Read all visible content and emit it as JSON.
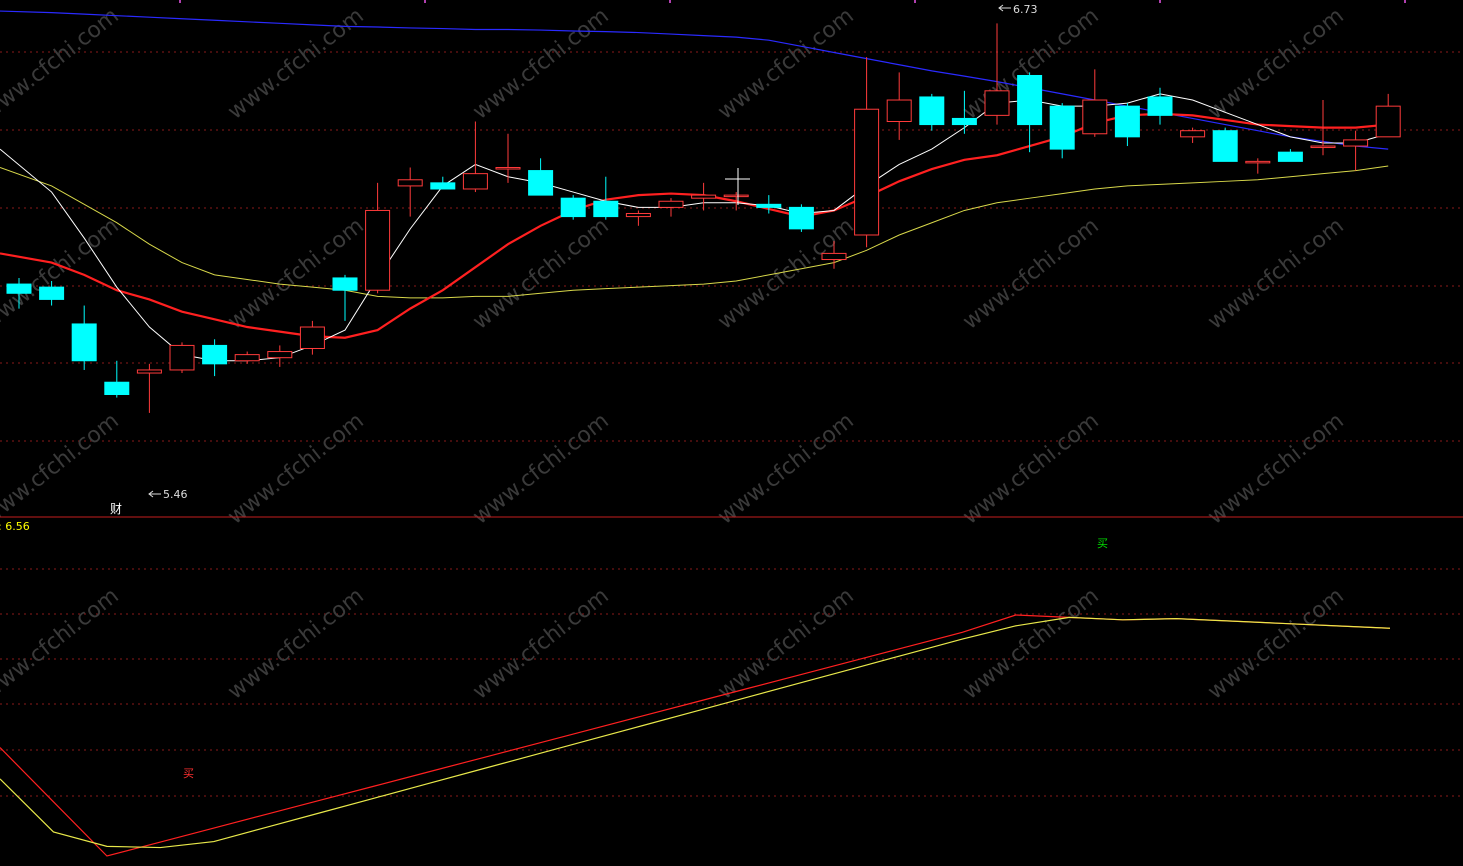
{
  "colors": {
    "background": "#000000",
    "up": "#ff3b3b",
    "down": "#00ffff",
    "gridline": "#8a1a1a",
    "divider": "#c41e1e",
    "ma_fast": "#ffffff",
    "ma_mid": "#ff2020",
    "ma_slow": "#d8d84a",
    "ma_long": "#2a2aff",
    "label_text": "#dddddd",
    "indicator_value": "#ffff00",
    "buy_red": "#ff3030",
    "buy_green": "#00dd00",
    "osc_a": "#ff2020",
    "osc_b": "#e8e84a",
    "watermark": "#3a3a3a"
  },
  "annotations": {
    "high_label": "6.73",
    "low_label": "5.46",
    "finance_marker": "财",
    "indicator_value_label": ": 6.56",
    "buy_signal_1": "买",
    "buy_signal_2": "买"
  },
  "watermark_text": "www.cfchi.com",
  "chart_data": [
    {
      "type": "candlestick",
      "title": "",
      "xlabel": "",
      "ylabel": "",
      "ylim": [
        5.15,
        6.78
      ],
      "grid": true,
      "candles": [
        {
          "o": 5.88,
          "c": 5.85,
          "h": 5.9,
          "l": 5.8
        },
        {
          "o": 5.87,
          "c": 5.83,
          "h": 5.89,
          "l": 5.81
        },
        {
          "o": 5.75,
          "c": 5.63,
          "h": 5.81,
          "l": 5.6
        },
        {
          "o": 5.56,
          "c": 5.52,
          "h": 5.63,
          "l": 5.51
        },
        {
          "o": 5.59,
          "c": 5.6,
          "h": 5.62,
          "l": 5.46
        },
        {
          "o": 5.6,
          "c": 5.68,
          "h": 5.69,
          "l": 5.59
        },
        {
          "o": 5.68,
          "c": 5.62,
          "h": 5.7,
          "l": 5.58
        },
        {
          "o": 5.63,
          "c": 5.65,
          "h": 5.66,
          "l": 5.62
        },
        {
          "o": 5.64,
          "c": 5.66,
          "h": 5.68,
          "l": 5.61
        },
        {
          "o": 5.67,
          "c": 5.74,
          "h": 5.76,
          "l": 5.65
        },
        {
          "o": 5.9,
          "c": 5.86,
          "h": 5.91,
          "l": 5.76
        },
        {
          "o": 5.86,
          "c": 6.12,
          "h": 6.21,
          "l": 5.85
        },
        {
          "o": 6.2,
          "c": 6.22,
          "h": 6.26,
          "l": 6.1
        },
        {
          "o": 6.21,
          "c": 6.19,
          "h": 6.23,
          "l": 6.19
        },
        {
          "o": 6.19,
          "c": 6.24,
          "h": 6.41,
          "l": 6.18
        },
        {
          "o": 6.26,
          "c": 6.26,
          "h": 6.37,
          "l": 6.21
        },
        {
          "o": 6.25,
          "c": 6.17,
          "h": 6.29,
          "l": 6.17
        },
        {
          "o": 6.16,
          "c": 6.1,
          "h": 6.17,
          "l": 6.09
        },
        {
          "o": 6.15,
          "c": 6.1,
          "h": 6.23,
          "l": 6.09
        },
        {
          "o": 6.1,
          "c": 6.11,
          "h": 6.12,
          "l": 6.07
        },
        {
          "o": 6.13,
          "c": 6.15,
          "h": 6.16,
          "l": 6.1
        },
        {
          "o": 6.16,
          "c": 6.17,
          "h": 6.21,
          "l": 6.12
        },
        {
          "o": 6.17,
          "c": 6.17,
          "h": 6.18,
          "l": 6.12
        },
        {
          "o": 6.14,
          "c": 6.13,
          "h": 6.17,
          "l": 6.11
        },
        {
          "o": 6.13,
          "c": 6.06,
          "h": 6.14,
          "l": 6.05
        },
        {
          "o": 5.96,
          "c": 5.98,
          "h": 6.02,
          "l": 5.93
        },
        {
          "o": 6.04,
          "c": 6.45,
          "h": 6.62,
          "l": 6.0
        },
        {
          "o": 6.41,
          "c": 6.48,
          "h": 6.57,
          "l": 6.35
        },
        {
          "o": 6.49,
          "c": 6.4,
          "h": 6.5,
          "l": 6.38
        },
        {
          "o": 6.42,
          "c": 6.4,
          "h": 6.51,
          "l": 6.37
        },
        {
          "o": 6.43,
          "c": 6.51,
          "h": 6.73,
          "l": 6.4
        },
        {
          "o": 6.56,
          "c": 6.4,
          "h": 6.57,
          "l": 6.31
        },
        {
          "o": 6.46,
          "c": 6.32,
          "h": 6.47,
          "l": 6.29
        },
        {
          "o": 6.37,
          "c": 6.48,
          "h": 6.58,
          "l": 6.36
        },
        {
          "o": 6.46,
          "c": 6.36,
          "h": 6.47,
          "l": 6.33
        },
        {
          "o": 6.49,
          "c": 6.43,
          "h": 6.52,
          "l": 6.4
        },
        {
          "o": 6.36,
          "c": 6.38,
          "h": 6.39,
          "l": 6.34
        },
        {
          "o": 6.38,
          "c": 6.28,
          "h": 6.39,
          "l": 6.28
        },
        {
          "o": 6.28,
          "c": 6.28,
          "h": 6.29,
          "l": 6.24
        },
        {
          "o": 6.31,
          "c": 6.28,
          "h": 6.32,
          "l": 6.28
        },
        {
          "o": 6.33,
          "c": 6.33,
          "h": 6.48,
          "l": 6.3
        },
        {
          "o": 6.33,
          "c": 6.35,
          "h": 6.38,
          "l": 6.25
        },
        {
          "o": 6.36,
          "c": 6.46,
          "h": 6.5,
          "l": 6.36
        }
      ],
      "series": [
        {
          "role": "ma_long",
          "values": [
            6.77,
            6.765,
            6.76,
            6.755,
            6.75,
            6.745,
            6.74,
            6.735,
            6.73,
            6.725,
            6.72,
            6.718,
            6.715,
            6.713,
            6.71,
            6.71,
            6.708,
            6.705,
            6.703,
            6.7,
            6.695,
            6.69,
            6.685,
            6.675,
            6.655,
            6.635,
            6.615,
            6.595,
            6.575,
            6.558,
            6.54,
            6.52,
            6.5,
            6.48,
            6.46,
            6.44,
            6.42,
            6.4,
            6.38,
            6.36,
            6.345,
            6.33,
            6.32
          ]
        },
        {
          "role": "ma_slow",
          "values": [
            6.26,
            6.2,
            6.14,
            6.08,
            6.01,
            5.95,
            5.91,
            5.895,
            5.88,
            5.87,
            5.86,
            5.84,
            5.835,
            5.835,
            5.84,
            5.84,
            5.85,
            5.86,
            5.865,
            5.87,
            5.875,
            5.88,
            5.89,
            5.91,
            5.93,
            5.95,
            5.99,
            6.04,
            6.08,
            6.12,
            6.145,
            6.16,
            6.175,
            6.19,
            6.2,
            6.205,
            6.21,
            6.215,
            6.22,
            6.23,
            6.24,
            6.25,
            6.265
          ]
        },
        {
          "role": "ma_mid",
          "values": [
            5.98,
            5.95,
            5.91,
            5.86,
            5.83,
            5.79,
            5.765,
            5.74,
            5.725,
            5.71,
            5.705,
            5.73,
            5.8,
            5.86,
            5.935,
            6.01,
            6.07,
            6.12,
            6.155,
            6.17,
            6.175,
            6.17,
            6.15,
            6.125,
            6.1,
            6.12,
            6.165,
            6.215,
            6.255,
            6.285,
            6.3,
            6.33,
            6.36,
            6.405,
            6.43,
            6.435,
            6.43,
            6.415,
            6.4,
            6.395,
            6.39,
            6.39,
            6.4
          ]
        },
        {
          "role": "ma_fast",
          "values": [
            6.32,
            6.18,
            6.03,
            5.87,
            5.74,
            5.65,
            5.63,
            5.63,
            5.64,
            5.68,
            5.73,
            5.9,
            6.06,
            6.2,
            6.27,
            6.23,
            6.21,
            6.18,
            6.15,
            6.13,
            6.13,
            6.145,
            6.145,
            6.135,
            6.11,
            6.12,
            6.2,
            6.27,
            6.32,
            6.39,
            6.47,
            6.48,
            6.46,
            6.46,
            6.47,
            6.5,
            6.48,
            6.44,
            6.4,
            6.36,
            6.34,
            6.34,
            6.37
          ]
        }
      ]
    },
    {
      "type": "line",
      "title": "",
      "xlabel": "",
      "ylabel": "",
      "grid": true,
      "series": [
        {
          "role": "osc_a",
          "values": [
            0.45,
            0.225,
            0.0,
            0.058,
            0.116,
            0.174,
            0.232,
            0.29,
            0.348,
            0.406,
            0.464,
            0.522,
            0.58,
            0.638,
            0.696,
            0.754,
            0.812,
            0.87,
            0.928,
            1.0,
            0.99,
            0.98,
            0.985,
            0.975,
            0.965,
            0.955,
            0.945
          ]
        },
        {
          "role": "osc_b",
          "values": [
            0.32,
            0.1,
            0.04,
            0.035,
            0.06,
            0.12,
            0.18,
            0.24,
            0.3,
            0.36,
            0.42,
            0.48,
            0.54,
            0.6,
            0.66,
            0.72,
            0.78,
            0.84,
            0.9,
            0.955,
            0.99,
            0.98,
            0.985,
            0.975,
            0.965,
            0.955,
            0.945
          ]
        }
      ]
    }
  ]
}
